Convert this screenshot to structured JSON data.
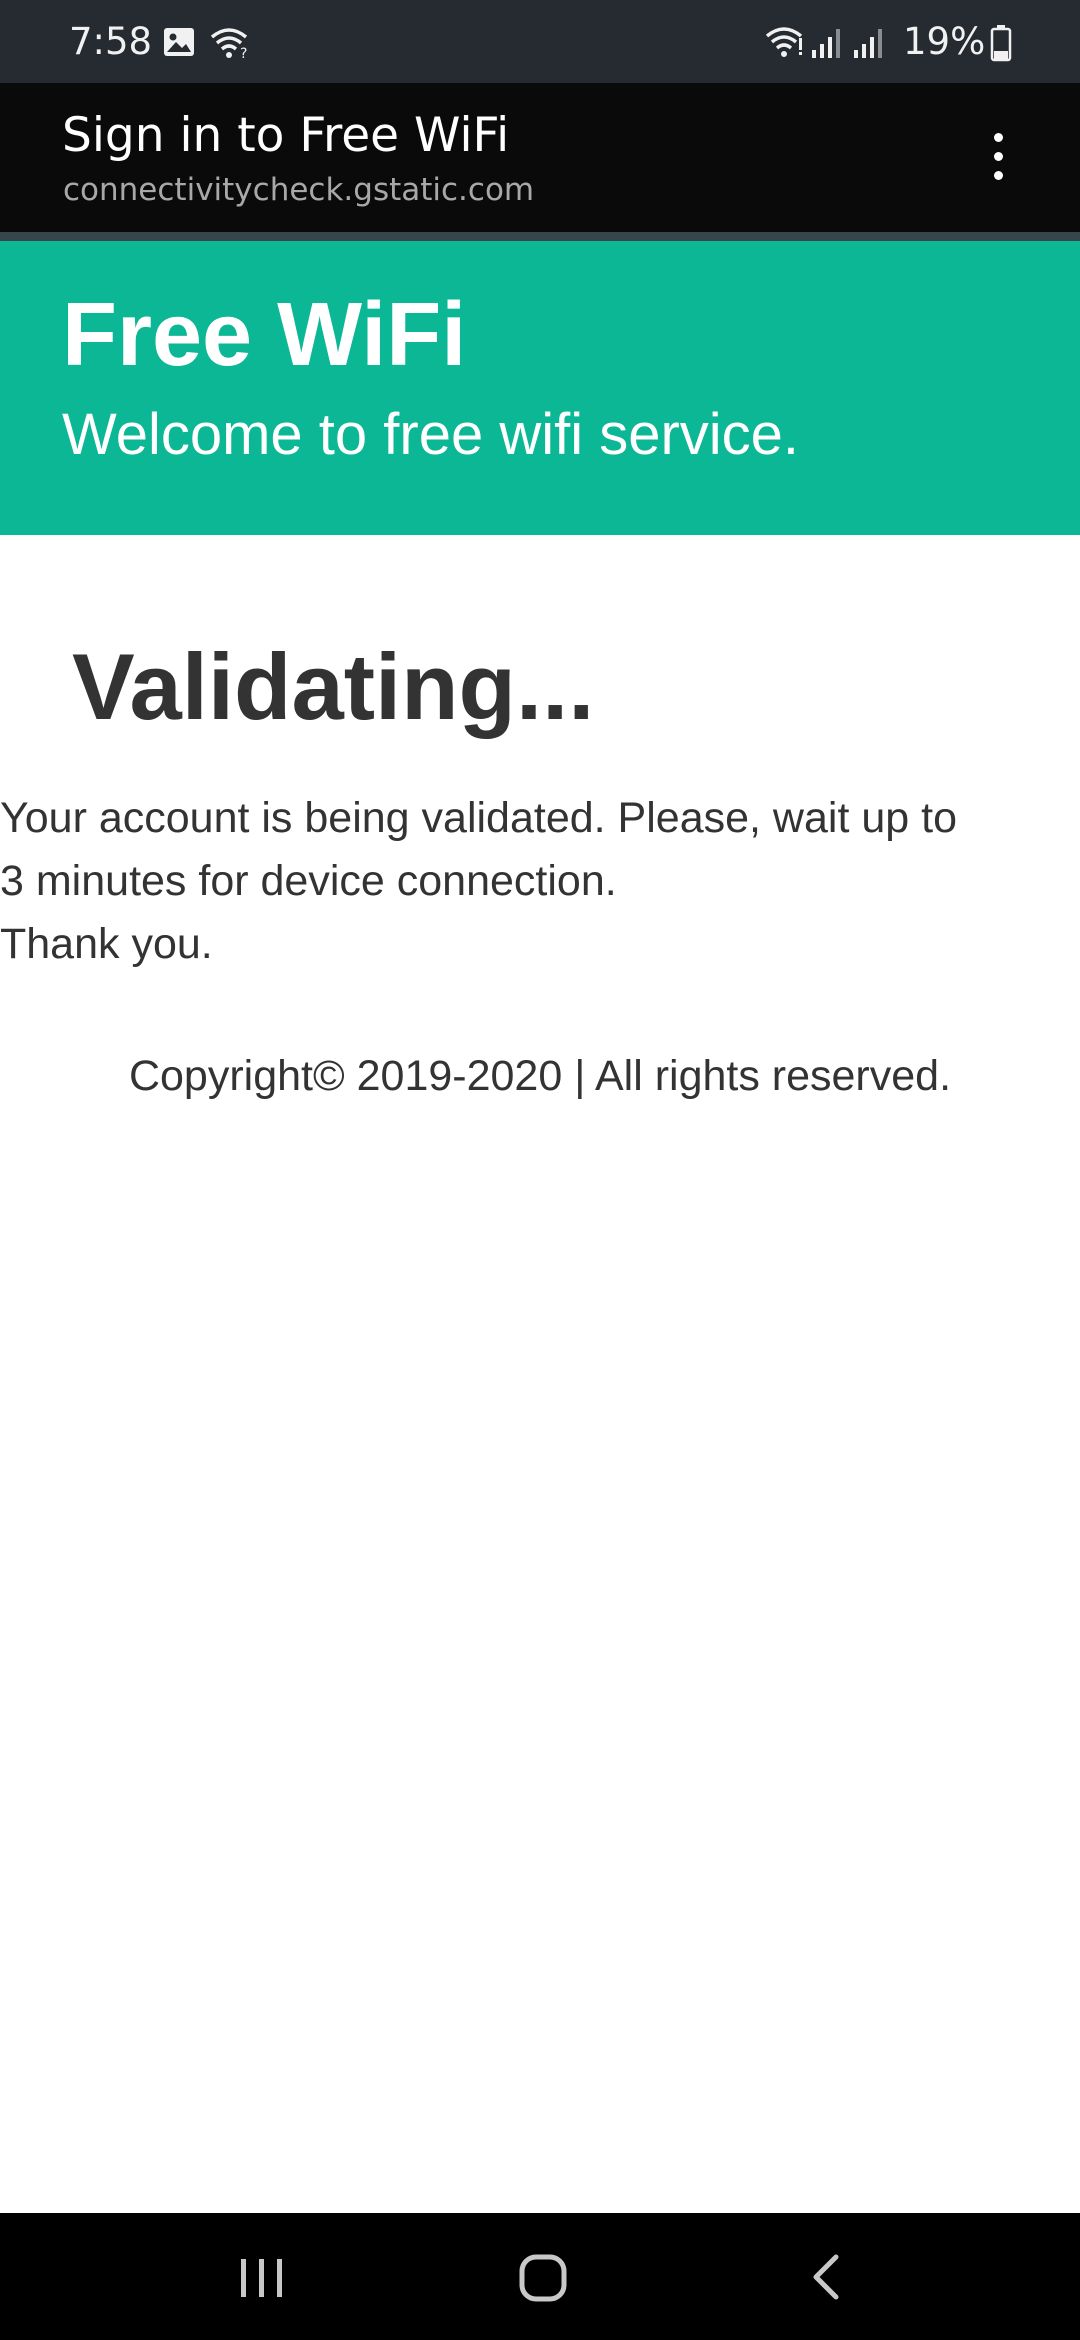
{
  "status_bar": {
    "time": "7:58",
    "battery_percent": "19%",
    "icons": [
      "gallery-icon",
      "wifi-question-icon",
      "wifi-icon",
      "signal-icon-1",
      "signal-icon-2",
      "battery-icon"
    ]
  },
  "title_bar": {
    "title": "Sign in to Free WiFi",
    "url": "connectivitycheck.gstatic.com",
    "menu_icon": "more-vertical-icon"
  },
  "banner": {
    "title": "Free WiFi",
    "subtitle": "Welcome to free wifi service.",
    "background_color": "#0bb795"
  },
  "content": {
    "heading": "Validating...",
    "message_lines": [
      "Your account is being validated. Please, wait up to",
      "3 minutes for device connection.",
      "Thank you."
    ],
    "copyright": "Copyright© 2019-2020 | All rights reserved."
  },
  "nav_bar": {
    "buttons": [
      "recent-apps-icon",
      "home-icon",
      "back-icon"
    ]
  }
}
